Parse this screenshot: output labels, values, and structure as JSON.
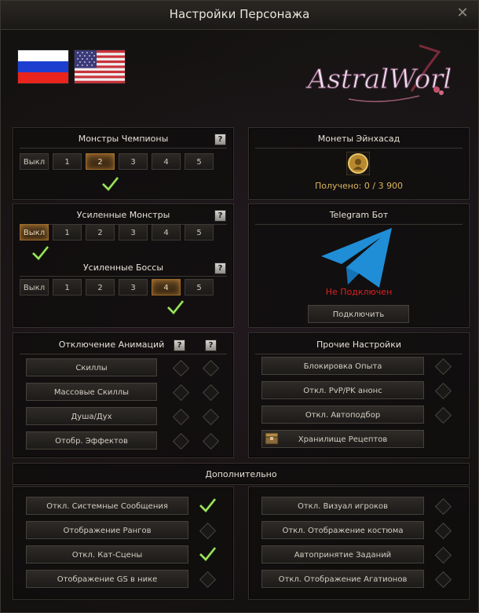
{
  "window": {
    "title": "Настройки Персонажа",
    "close_glyph": "✕"
  },
  "languages": [
    "russian-flag",
    "usa-flag"
  ],
  "champions": {
    "title": "Монстры Чемпионы",
    "help": "?",
    "levels": [
      "Выкл",
      "1",
      "2",
      "3",
      "4",
      "5"
    ],
    "selected": "2"
  },
  "coins": {
    "title": "Монеты Эйнхасад",
    "received": "Получено: 0 / 3 900",
    "icon": "einhasad-coin-icon"
  },
  "enhanced": {
    "monsters_title": "Усиленные Монстры",
    "monsters_levels": [
      "Выкл",
      "1",
      "2",
      "3",
      "4",
      "5"
    ],
    "monsters_selected": "Выкл",
    "bosses_title": "Усиленные Боссы",
    "bosses_levels": [
      "Выкл",
      "1",
      "2",
      "3",
      "4",
      "5"
    ],
    "bosses_selected": "4",
    "help": "?"
  },
  "telegram": {
    "title": "Telegram Бот",
    "status": "Не Подключен",
    "connect": "Подключить",
    "icon": "telegram-icon",
    "status_color": "#e02020"
  },
  "animations": {
    "title": "Отключение Анимаций",
    "help": "?",
    "items": [
      "Скиллы",
      "Массовые Скиллы",
      "Душа/Дух",
      "Отобр. Эффектов"
    ]
  },
  "other": {
    "title": "Прочие Настройки",
    "items": [
      "Блокировка Опыта",
      "Откл. PvP/PK анонс",
      "Откл. Автоподбор",
      "Хранилище Рецептов"
    ]
  },
  "additional": {
    "title": "Дополнительно",
    "left": [
      {
        "label": "Откл. Системные Сообщения",
        "checked": true
      },
      {
        "label": "Отображение Рангов",
        "checked": false
      },
      {
        "label": "Откл. Кат-Сцены",
        "checked": true
      },
      {
        "label": "Отображение GS в нике",
        "checked": false
      }
    ],
    "right": [
      {
        "label": "Откл. Визуал игроков",
        "checked": false
      },
      {
        "label": "Откл. Отображение костюма",
        "checked": false
      },
      {
        "label": "Автопринятие Заданий",
        "checked": false
      },
      {
        "label": "Откл. Отображение Агатионов",
        "checked": false
      }
    ]
  },
  "logo": {
    "text": "AstralWorld"
  },
  "colors": {
    "accent": "#9a6a2a",
    "check": "#7fd12f",
    "gold": "#d9b45c"
  }
}
